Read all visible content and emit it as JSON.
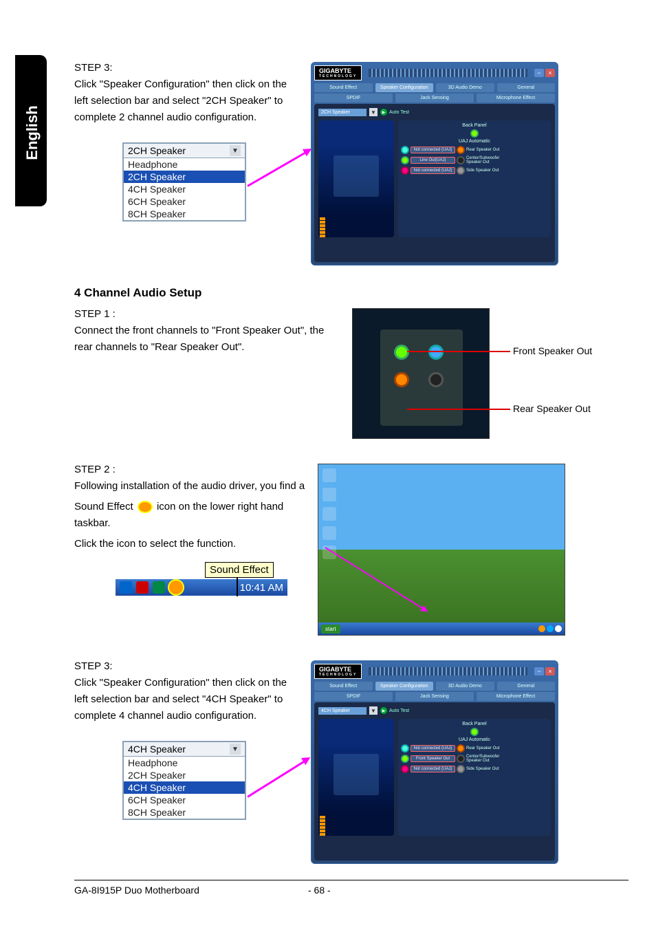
{
  "side_tab": "English",
  "section_top": {
    "step_label": "STEP 3:",
    "body": "Click \"Speaker Configuration\" then click on the left selection bar and select \"2CH Speaker\" to complete 2 channel audio configuration.",
    "dropdown": {
      "selected": "2CH Speaker",
      "highlighted": "2CH Speaker",
      "options": [
        "Headphone",
        "2CH Speaker",
        "4CH Speaker",
        "6CH Speaker",
        "8CH Speaker"
      ]
    }
  },
  "audio_panel": {
    "logo": "GIGABYTE",
    "logo_sub": "TECHNOLOGY",
    "tabs_row1": [
      "Sound Effect",
      "Speaker Configuration",
      "3D Audio Demo",
      "General"
    ],
    "tabs_row2": [
      "SPDIF",
      "Jack Sensing",
      "Microphone Effect"
    ],
    "active_tab": "Speaker Configuration",
    "speaker_sel_2ch": "2CH Speaker",
    "speaker_sel_4ch": "4CH Speaker",
    "auto_test": "Auto Test",
    "back_panel_title": "Back Panel",
    "uaj_auto": "UAJ Automatic",
    "jacks_2ch": [
      {
        "status": "Not connected (UAJ)",
        "out": "Rear Speaker Out"
      },
      {
        "status": "Line Out(UAJ)",
        "out": "Center/Subwoofer Speaker Out"
      },
      {
        "status": "Not connected (UAJ)",
        "out": "Side Speaker Out"
      }
    ],
    "jacks_4ch": [
      {
        "status": "Not connected (UAJ)",
        "out": "Rear Speaker Out"
      },
      {
        "status": "Front Speaker Out",
        "out": "Center/Subwoofer Speaker Out"
      },
      {
        "status": "Not connected (UAJ)",
        "out": "Side Speaker Out"
      }
    ]
  },
  "section_4ch": {
    "title": "4 Channel Audio Setup",
    "step1_label": "STEP 1 :",
    "step1_body": "Connect the front channels to \"Front Speaker Out\", the rear channels to \"Rear Speaker Out\".",
    "callout_front": "Front Speaker Out",
    "callout_rear": "Rear Speaker Out",
    "step2_label": "STEP 2 :",
    "step2_body_a": "Following installation of the audio driver, you find a",
    "step2_body_b": "Sound Effect ",
    "step2_body_c": " icon on the lower right hand taskbar.",
    "step2_body_d": "Click the icon to select the function.",
    "sound_effect_tooltip": "Sound Effect",
    "tray_time": "10:41 AM",
    "step3_label": "STEP 3:",
    "step3_body": "Click \"Speaker Configuration\" then click on the left selection bar and select \"4CH Speaker\" to complete 4 channel audio configuration.",
    "dropdown": {
      "selected": "4CH Speaker",
      "highlighted": "4CH Speaker",
      "options": [
        "Headphone",
        "2CH Speaker",
        "4CH Speaker",
        "6CH Speaker",
        "8CH Speaker"
      ]
    }
  },
  "desktop": {
    "start_label": "start"
  },
  "footer": {
    "left": "GA-8I915P Duo Motherboard",
    "center": "- 68 -"
  }
}
